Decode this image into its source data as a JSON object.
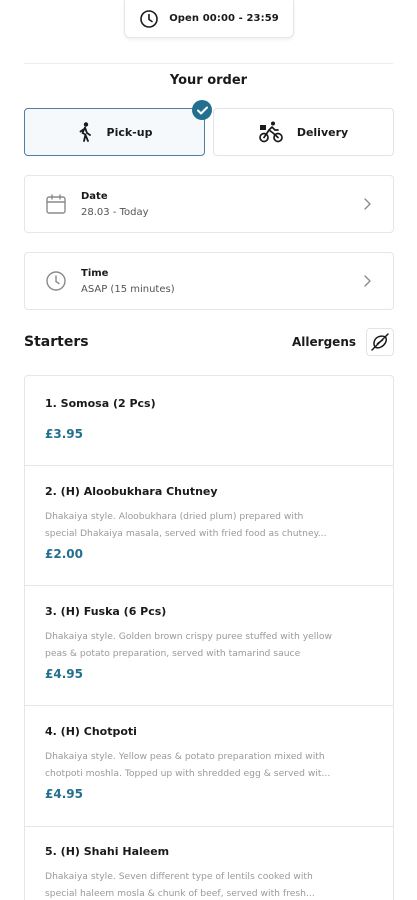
{
  "header": {
    "hours_text": "Open 00:00 - 23:59",
    "icon": "clock-icon"
  },
  "order": {
    "title": "Your order",
    "modes": [
      {
        "label": "Pick-up",
        "icon": "walking-person-icon",
        "selected": true
      },
      {
        "label": "Delivery",
        "icon": "delivery-bike-icon",
        "selected": false
      }
    ],
    "date": {
      "label": "Date",
      "value": "28.03 - Today",
      "icon": "calendar-icon"
    },
    "time": {
      "label": "Time",
      "value": "ASAP (15 minutes)",
      "icon": "clock-icon"
    }
  },
  "starters": {
    "title": "Starters",
    "allergens_label": "Allergens",
    "allergens_icon": "allergen-filter-icon",
    "items": [
      {
        "name": "1. Somosa (2 Pcs)",
        "description": "",
        "price": "£3.95"
      },
      {
        "name": "2. (H) Aloobukhara Chutney",
        "description": "Dhakaiya style. Aloobukhara (dried plum) prepared with\nspecial Dhakaiya masala, served with fried food as chutney...",
        "price": "£2.00"
      },
      {
        "name": "3. (H) Fuska (6 Pcs)",
        "description": "Dhakaiya style. Golden brown crispy puree stuffed with yellow\npeas & potato preparation, served with tamarind sauce",
        "price": "£4.95"
      },
      {
        "name": "4. (H) Chotpoti",
        "description": "Dhakaiya style. Yellow peas & potato preparation mixed with\nchotpoti moshla. Topped up with shredded egg & served wit...",
        "price": "£4.95"
      },
      {
        "name": "5. (H) Shahi Haleem",
        "description": "Dhakaiya style. Seven different type of lentils cooked with\nspecial haleem mosla & chunk of beef, served with fresh...",
        "price": ""
      }
    ]
  },
  "colors": {
    "accent": "#22708f",
    "selected_border": "#4f7fa8",
    "border": "#e6e6e6",
    "muted_text": "#9a9a9a"
  }
}
